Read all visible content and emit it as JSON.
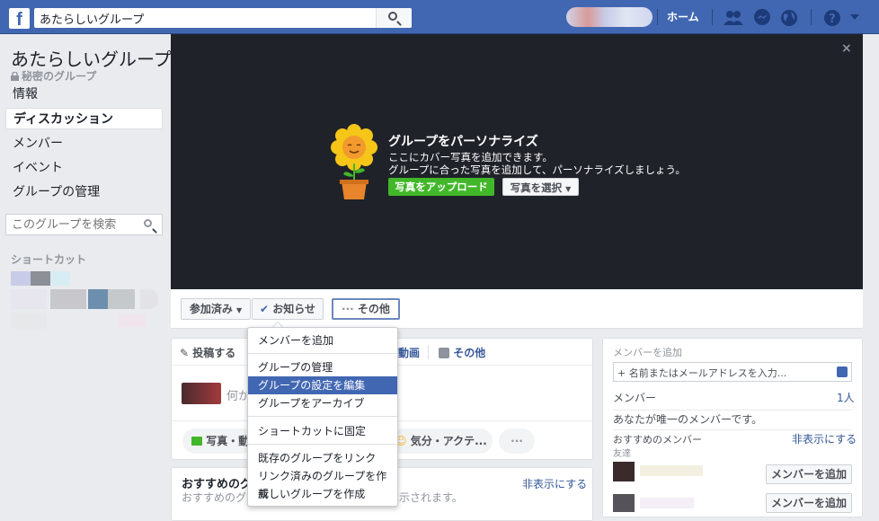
{
  "topbar": {
    "search_value": "あたらしいグループ",
    "home_label": "ホーム",
    "icons": [
      "facebook-logo-icon",
      "search-icon",
      "friends-icon",
      "messenger-icon",
      "globe-icon",
      "help-icon",
      "dropdown-arrow-icon"
    ]
  },
  "sidebar": {
    "group_name": "あたらしいグループ",
    "privacy": "秘密のグループ",
    "items": [
      {
        "label": "情報"
      },
      {
        "label": "ディスカッション"
      },
      {
        "label": "メンバー"
      },
      {
        "label": "イベント"
      },
      {
        "label": "グループの管理"
      }
    ],
    "search_placeholder": "このグループを検索",
    "shortcuts_label": "ショートカット"
  },
  "cover": {
    "title": "グループをパーソナライズ",
    "line1": "ここにカバー写真を追加できます。",
    "line2": "グループに合った写真を追加して、パーソナライズしましょう。",
    "upload_label": "写真をアップロード",
    "select_label": "写真を選択",
    "close_label": "×"
  },
  "actions": {
    "joined_label": "参加済み",
    "notify_label": "お知らせ",
    "more_label": "その他",
    "more_dots": "···"
  },
  "composer": {
    "post_tab": "投稿する",
    "video_tab": "動画",
    "more_tab": "その他",
    "prompt": "何か",
    "photo_pill": "写真・動",
    "feeling_pill": "気分・アクテ...",
    "more_pill": "···"
  },
  "suggested": {
    "title": "おすすめのグ",
    "desc_start": "おすすめのグ",
    "desc_end": "示されます。",
    "hide_label": "非表示にする"
  },
  "dropdown": {
    "items": [
      {
        "label": "メンバーを追加",
        "highlighted": false
      },
      {
        "label": "グループの管理",
        "highlighted": false
      },
      {
        "label": "グループの設定を編集",
        "highlighted": true
      },
      {
        "label": "グループをアーカイブ",
        "highlighted": false
      },
      {
        "label": "ショートカットに固定",
        "highlighted": false
      },
      {
        "label": "既存のグループをリンク",
        "highlighted": false
      },
      {
        "label": "リンク済みのグループを作成",
        "highlighted": false
      },
      {
        "label": "新しいグループを作成",
        "highlighted": false
      }
    ]
  },
  "right": {
    "add_member_title": "メンバーを追加",
    "add_member_placeholder": "+ 名前またはメールアドレスを入力...",
    "members_title": "メンバー",
    "members_count": "1人",
    "only_member_text": "あなたが唯一のメンバーです。",
    "suggested_members_title": "おすすめのメンバー",
    "hide_label": "非表示にする",
    "friends_label": "友達",
    "add_button_label": "メンバーを追加"
  },
  "colors": {
    "brand": "#4267b2",
    "cover_bg": "#1f2329",
    "upload_green": "#42b72a",
    "link": "#365899"
  }
}
